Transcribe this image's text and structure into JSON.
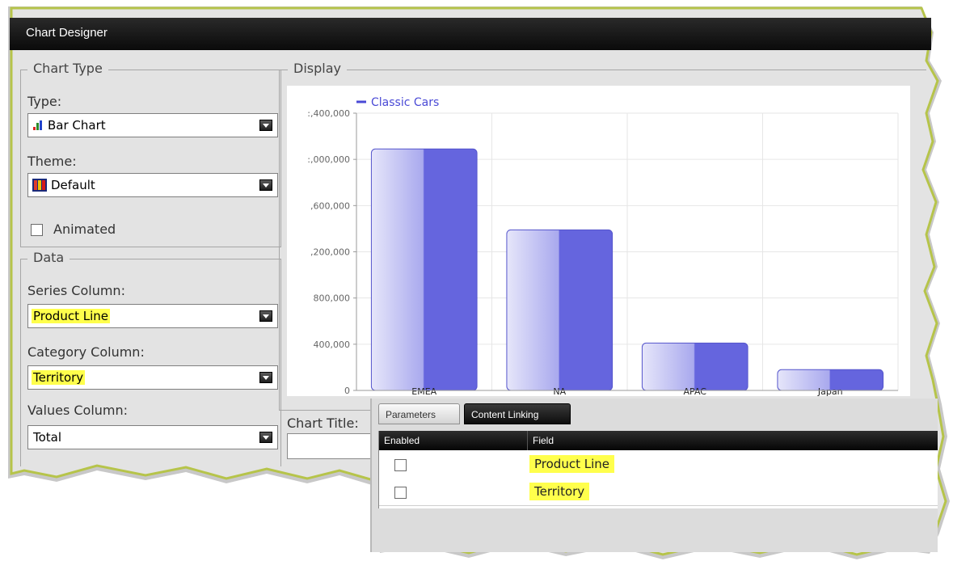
{
  "window": {
    "title": "Chart Designer"
  },
  "chart_type_group": {
    "legend": "Chart Type",
    "type_label": "Type:",
    "type_value": "Bar Chart",
    "type_icon": "bar-chart-icon",
    "theme_label": "Theme:",
    "theme_value": "Default",
    "theme_icon": "theme-palette-icon",
    "animated_label": "Animated",
    "animated_checked": false
  },
  "data_group": {
    "legend": "Data",
    "series_label": "Series Column:",
    "series_value": "Product Line",
    "category_label": "Category Column:",
    "category_value": "Territory",
    "values_label": "Values Column:",
    "values_value": "Total"
  },
  "display": {
    "legend": "Display"
  },
  "chart_title": {
    "label": "Chart Title:",
    "value": ""
  },
  "tabs": [
    {
      "label": "Parameters",
      "active": false
    },
    {
      "label": "Content Linking",
      "active": true
    }
  ],
  "linking_grid": {
    "headers": [
      "Enabled",
      "Field"
    ],
    "rows": [
      {
        "enabled": false,
        "field": "Product Line"
      },
      {
        "enabled": false,
        "field": "Territory"
      }
    ]
  },
  "colors": {
    "bar": "#6565de",
    "highlight": "#ffff4c",
    "series": "#4a4ad6"
  },
  "chart_data": {
    "type": "bar",
    "categories": [
      "EMEA",
      "NA",
      "APAC",
      "Japan"
    ],
    "series": [
      {
        "name": "Classic Cars",
        "values": [
          2090000,
          1390000,
          410000,
          180000
        ]
      }
    ],
    "y_tick_labels": [
      ":,400,000",
      ":,000,000",
      ",600,000",
      ",200,000",
      "800,000",
      "400,000",
      "0"
    ],
    "ylim": [
      0,
      2400000
    ],
    "grid": true,
    "legend_position": "top-left"
  }
}
